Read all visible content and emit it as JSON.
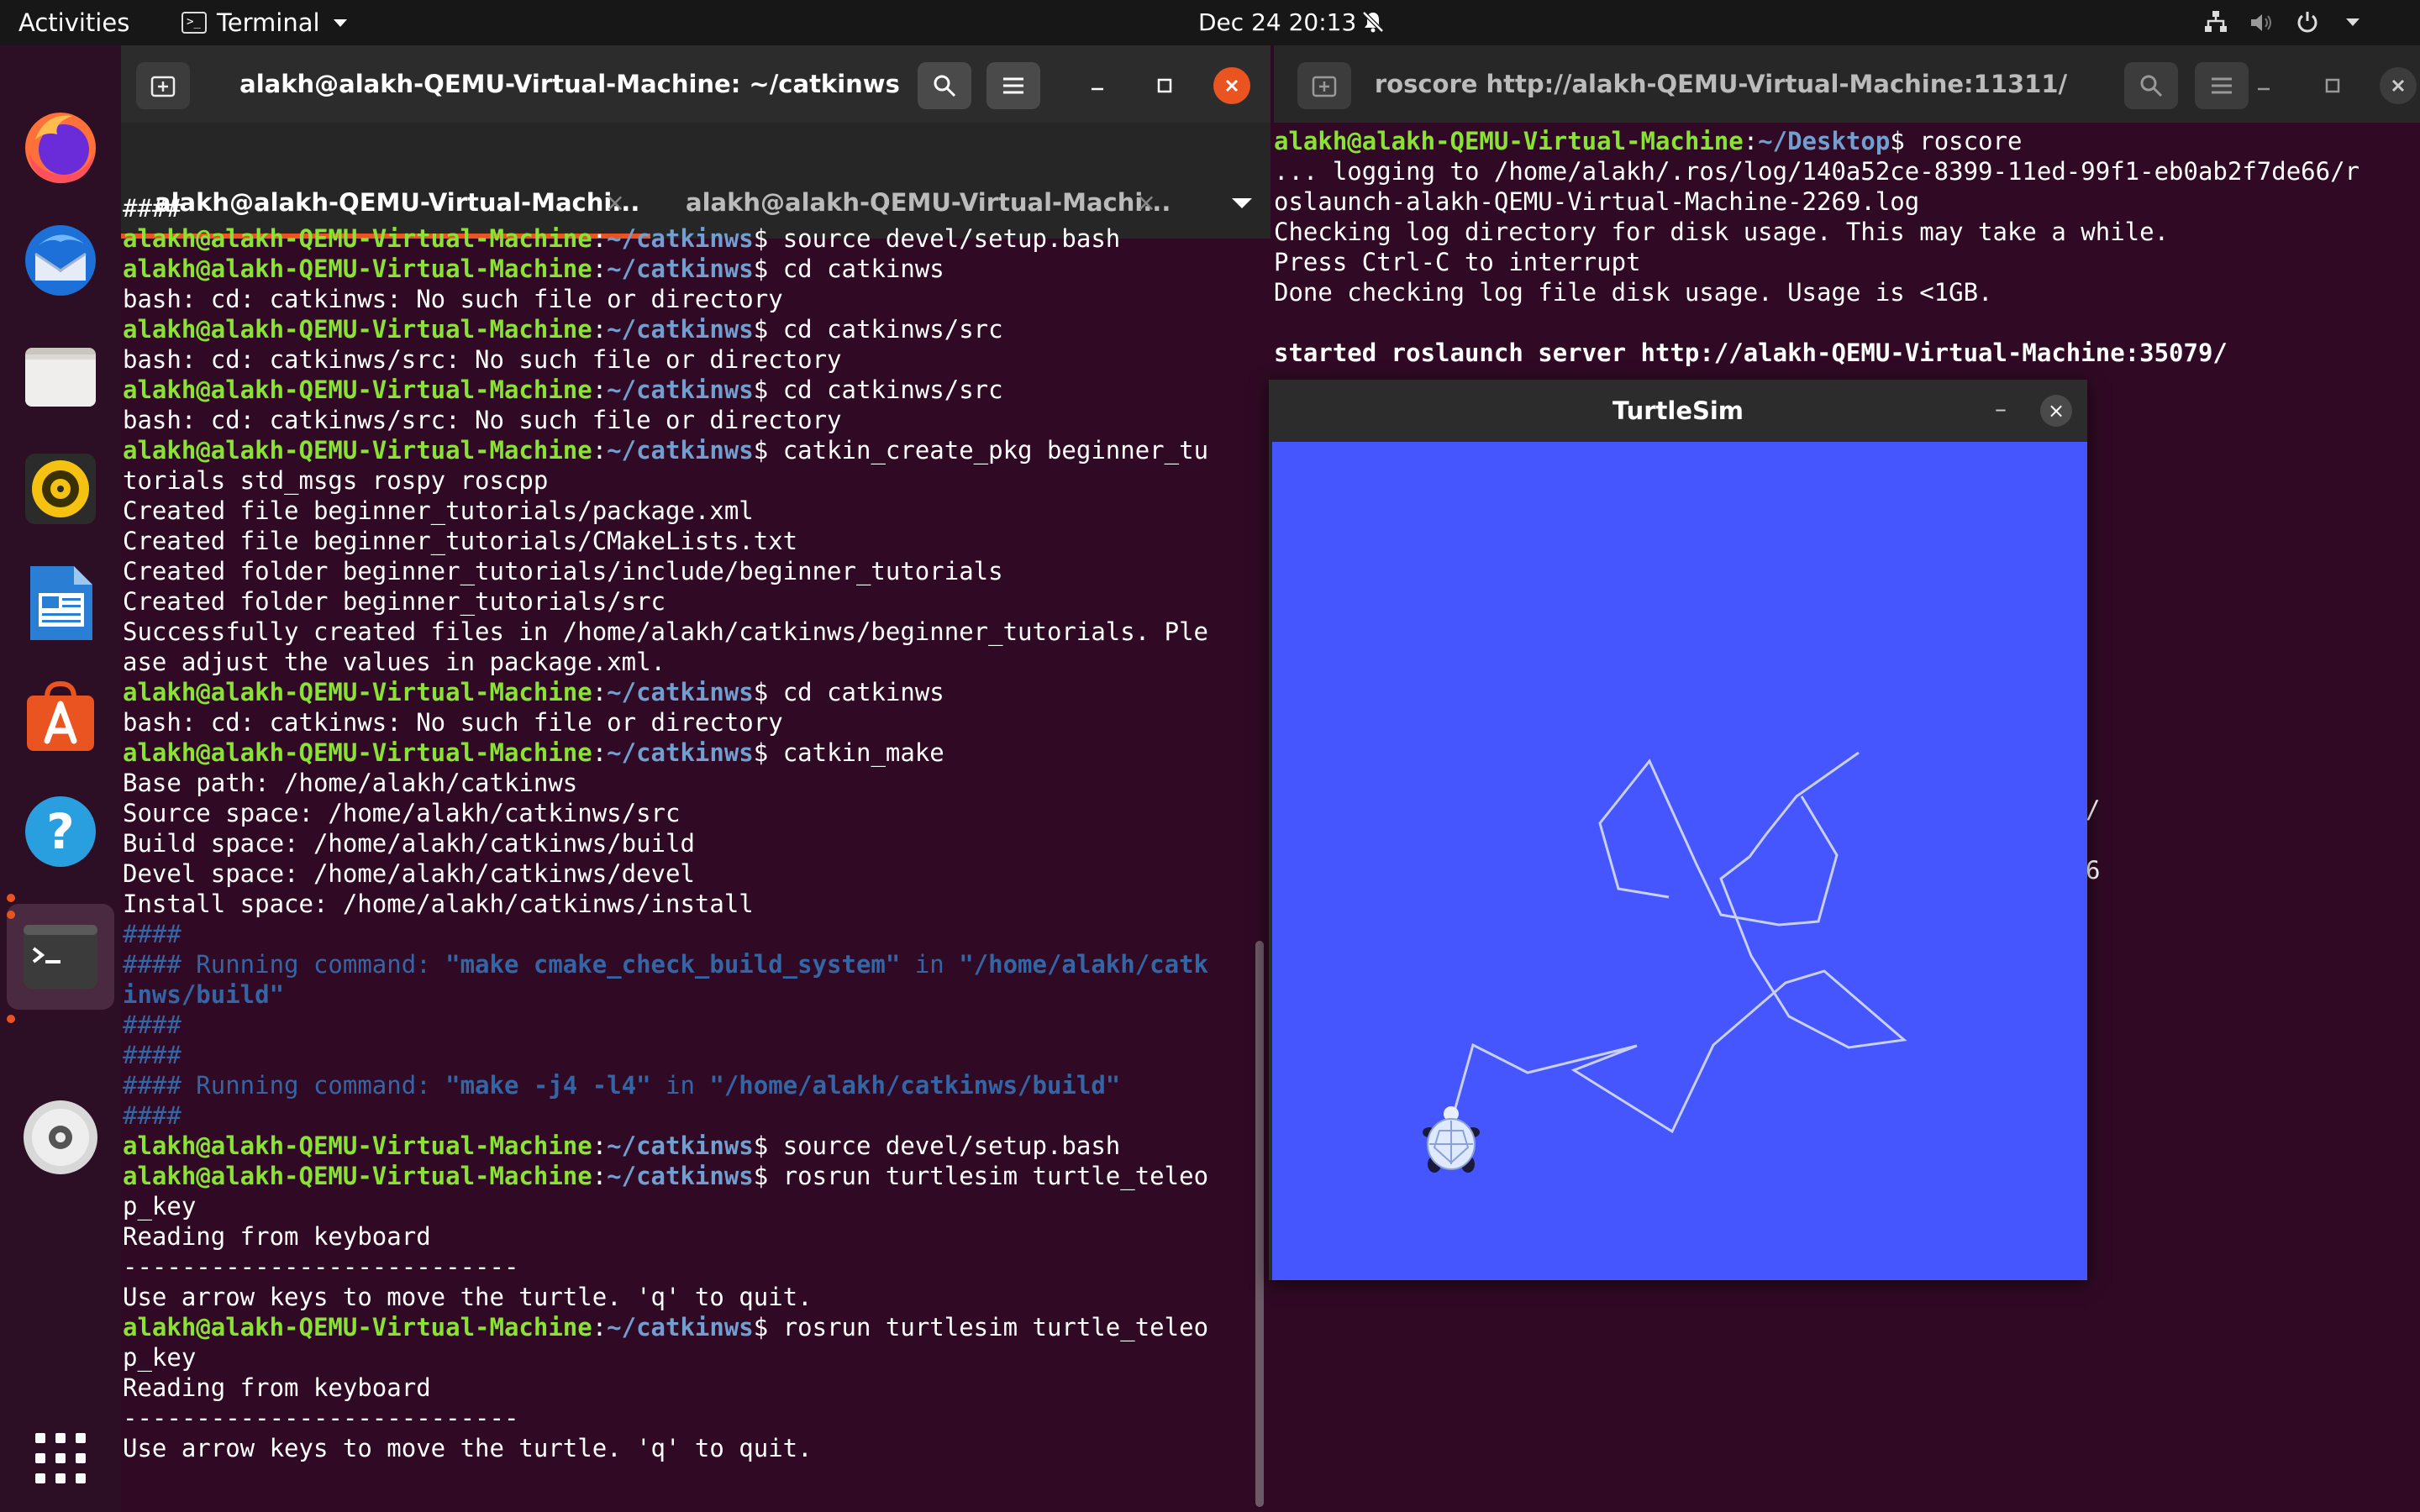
{
  "topbar": {
    "activities": "Activities",
    "app_name": "Terminal",
    "clock": "Dec 24  20:13"
  },
  "dock": {
    "items": [
      {
        "name": "Firefox",
        "icon": "firefox-icon"
      },
      {
        "name": "Thunderbird",
        "icon": "thunderbird-icon"
      },
      {
        "name": "Files",
        "icon": "files-icon"
      },
      {
        "name": "Rhythmbox",
        "icon": "rhythmbox-icon"
      },
      {
        "name": "LibreOffice Writer",
        "icon": "writer-icon"
      },
      {
        "name": "Ubuntu Software",
        "icon": "software-icon"
      },
      {
        "name": "Help",
        "icon": "help-icon"
      },
      {
        "name": "Terminal",
        "icon": "terminal-icon"
      },
      {
        "name": "DVD",
        "icon": "dvd-icon"
      },
      {
        "name": "Show Applications",
        "icon": "app-grid-icon"
      }
    ]
  },
  "colors": {
    "terminal_bg": "#300a24",
    "prompt_user": "#8ae234",
    "prompt_path": "#729fcf",
    "accent": "#e95420",
    "turtlesim_bg": "#4556ff"
  },
  "left_terminal": {
    "title": "alakh@alakh-QEMU-Virtual-Machine: ~/catkinws",
    "tabs": [
      {
        "label": "alakh@alakh-QEMU-Virtual-Machi...",
        "close": "×",
        "active": true
      },
      {
        "label": "alakh@alakh-QEMU-Virtual-Machi...",
        "close": "×",
        "active": false
      }
    ],
    "prompt_user": "alakh@alakh-QEMU-Virtual-Machine",
    "prompt_path": "~/catkinws",
    "lines": {
      "l1": "####",
      "l2_cmd": "$ source devel/setup.bash",
      "l3_cmd": "$ cd catkinws",
      "l4": "bash: cd: catkinws: No such file or directory",
      "l5_cmd": "$ cd catkinws/src",
      "l6": "bash: cd: catkinws/src: No such file or directory",
      "l7_cmd": "$ cd catkinws/src",
      "l8": "bash: cd: catkinws/src: No such file or directory",
      "l9_cmd": "$ catkin_create_pkg beginner_tu",
      "l10": "torials std_msgs rospy roscpp",
      "l11": "Created file beginner_tutorials/package.xml",
      "l12": "Created file beginner_tutorials/CMakeLists.txt",
      "l13": "Created folder beginner_tutorials/include/beginner_tutorials",
      "l14": "Created folder beginner_tutorials/src",
      "l15": "Successfully created files in /home/alakh/catkinws/beginner_tutorials. Ple",
      "l16": "ase adjust the values in package.xml.",
      "l17_cmd": "$ cd catkinws",
      "l18": "bash: cd: catkinws: No such file or directory",
      "l19_cmd": "$ catkin_make",
      "l20": "Base path: /home/alakh/catkinws",
      "l21": "Source space: /home/alakh/catkinws/src",
      "l22": "Build space: /home/alakh/catkinws/build",
      "l23": "Devel space: /home/alakh/catkinws/devel",
      "l24": "Install space: /home/alakh/catkinws/install",
      "l25": "####",
      "l26a": "#### Running command: ",
      "l26b": "\"make cmake_check_build_system\"",
      "l26c": " in ",
      "l26d": "\"/home/alakh/catk",
      "l27": "inws/build\"",
      "l28": "####",
      "l29": "####",
      "l30a": "#### Running command: ",
      "l30b": "\"make -j4 -l4\"",
      "l30c": " in ",
      "l30d": "\"/home/alakh/catkinws/build\"",
      "l31": "####",
      "l32_cmd": "$ source devel/setup.bash",
      "l33_cmd": "$ rosrun turtlesim turtle_teleo",
      "l34": "p_key",
      "l35": "Reading from keyboard",
      "l36": "---------------------------",
      "l37": "Use arrow keys to move the turtle. 'q' to quit.",
      "l38_cmd": "$ rosrun turtlesim turtle_teleo",
      "l39": "p_key",
      "l40": "Reading from keyboard",
      "l41": "---------------------------",
      "l42": "Use arrow keys to move the turtle. 'q' to quit."
    }
  },
  "right_terminal": {
    "title": "roscore http://alakh-QEMU-Virtual-Machine:11311/",
    "prompt_user": "alakh@alakh-QEMU-Virtual-Machine",
    "prompt_path": "~/Desktop",
    "lines": {
      "r1_cmd": "$ roscore",
      "r2": "... logging to /home/alakh/.ros/log/140a52ce-8399-11ed-99f1-eb0ab2f7de66/r",
      "r3": "oslaunch-alakh-QEMU-Virtual-Machine-2269.log",
      "r4": "Checking log directory for disk usage. This may take a while.",
      "r5": "Press Ctrl-C to interrupt",
      "r6": "Done checking log file disk usage. Usage is <1GB.",
      "r7": "started roslaunch server http://alakh-QEMU-Virtual-Machine:35079/",
      "r8": "/",
      "r9": "6"
    }
  },
  "turtlesim": {
    "title": "TurtleSim",
    "minimize": "–",
    "close": "×"
  }
}
